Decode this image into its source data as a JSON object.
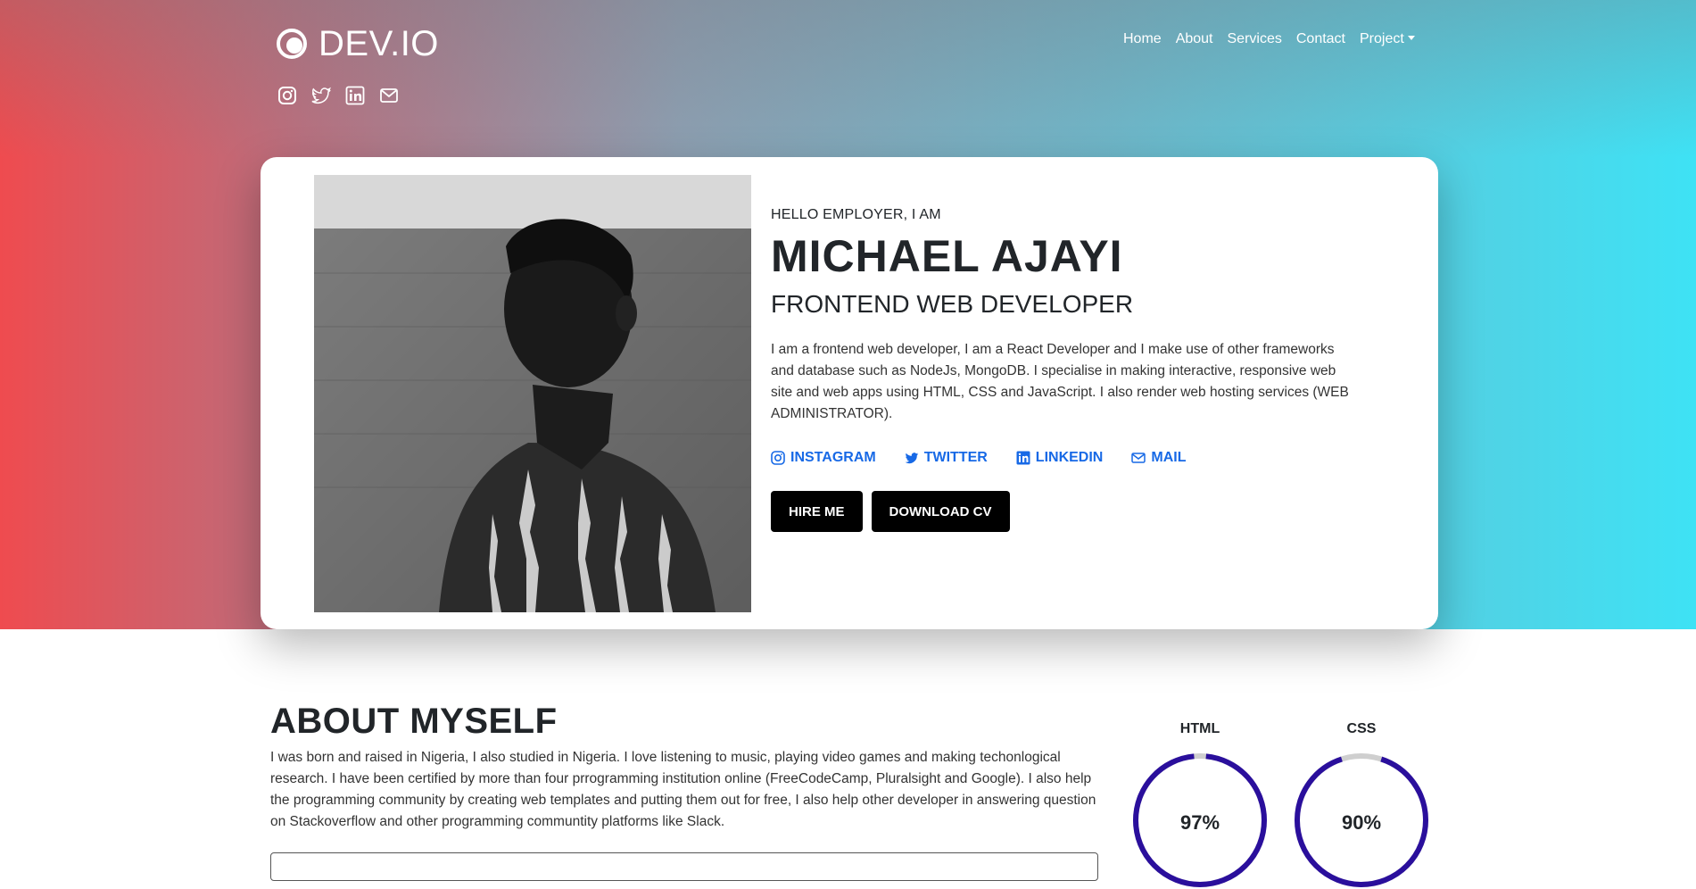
{
  "brand": {
    "name": "DEV.IO"
  },
  "nav": {
    "items": [
      {
        "label": "Home"
      },
      {
        "label": "About"
      },
      {
        "label": "Services"
      },
      {
        "label": "Contact"
      },
      {
        "label": "Project"
      }
    ]
  },
  "top_social_icons": [
    "instagram-icon",
    "twitter-icon",
    "linkedin-icon",
    "mail-icon"
  ],
  "hero": {
    "greeting": "HELLO EMPLOYER, I AM",
    "name": "MICHAEL AJAYI",
    "role": "FRONTEND WEB DEVELOPER",
    "bio": "I am a frontend web developer, I am a React Developer and I make use of other frameworks and database such as NodeJs, MongoDB. I specialise in making interactive, responsive web site and web apps using HTML, CSS and JavaScript. I also render web hosting services (WEB ADMINISTRATOR).",
    "social_links": [
      {
        "label": "INSTAGRAM",
        "icon": "instagram-icon"
      },
      {
        "label": "TWITTER",
        "icon": "twitter-icon"
      },
      {
        "label": "LINKEDIN",
        "icon": "linkedin-icon"
      },
      {
        "label": "MAIL",
        "icon": "mail-icon"
      }
    ],
    "buttons": {
      "hire": "HIRE ME",
      "cv": "DOWNLOAD CV"
    }
  },
  "about": {
    "title": "ABOUT MYSELF",
    "text": "I was born and raised in Nigeria, I also studied in Nigeria. I love listening to music, playing video games and making techonlogical research. I have been certified by more than four prrogramming institution online (FreeCodeCamp, Pluralsight and Google). I also help the programming community by creating web templates and putting them out for free, I also help other developer in answering question on Stackoverflow and other programming communtity platforms like Slack."
  },
  "skills": [
    {
      "label": "HTML",
      "value": "97%",
      "fraction": 0.97
    },
    {
      "label": "CSS",
      "value": "90%",
      "fraction": 0.9
    }
  ],
  "colors": {
    "gradient_left": "#ef4b4f",
    "gradient_right": "#3ee2f5",
    "link_blue": "#1769e6",
    "skill_ring": "#2a0f9c",
    "button_bg": "#000000"
  }
}
